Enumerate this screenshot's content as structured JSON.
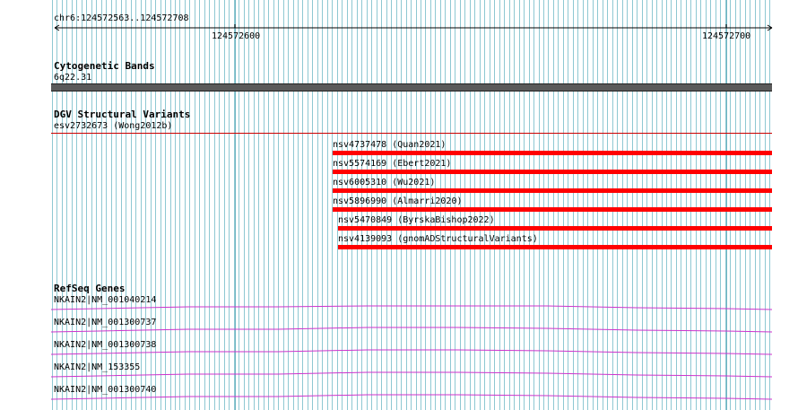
{
  "ruler": {
    "range_label": "chr6:124572563..124572708",
    "tick_left_label": "124572600",
    "tick_right_label": "124572700"
  },
  "cytobands": {
    "title": "Cytogenetic Bands",
    "band_label": "6q22.31"
  },
  "dgv": {
    "title": "DGV Structural Variants",
    "items": [
      {
        "label": "esv2732673 (Wong2012b)",
        "color": "#cc0000"
      },
      {
        "label": "nsv4737478 (Quan2021)",
        "color": "#ff0000"
      },
      {
        "label": "nsv5574169 (Ebert2021)",
        "color": "#ff0000"
      },
      {
        "label": "nsv6005310 (Wu2021)",
        "color": "#ff0000"
      },
      {
        "label": "nsv5896990 (Almarri2020)",
        "color": "#ff0000"
      },
      {
        "label": "nsv5470849 (ByrskaBishop2022)",
        "color": "#ff0000"
      },
      {
        "label": "nsv4139093 (gnomADStructuralVariants)",
        "color": "#ff0000"
      }
    ]
  },
  "refseq": {
    "title": "RefSeq Genes",
    "color": "#cc33cc",
    "genes": [
      {
        "label": "NKAIN2|NM_001040214"
      },
      {
        "label": "NKAIN2|NM_001300737"
      },
      {
        "label": "NKAIN2|NM_001300738"
      },
      {
        "label": "NKAIN2|NM_153355"
      },
      {
        "label": "NKAIN2|NM_001300740"
      }
    ]
  },
  "colors": {
    "grid_line": "#8ec8d2",
    "cytoband_fill": "#555555",
    "variant_red": "#ff0000"
  }
}
